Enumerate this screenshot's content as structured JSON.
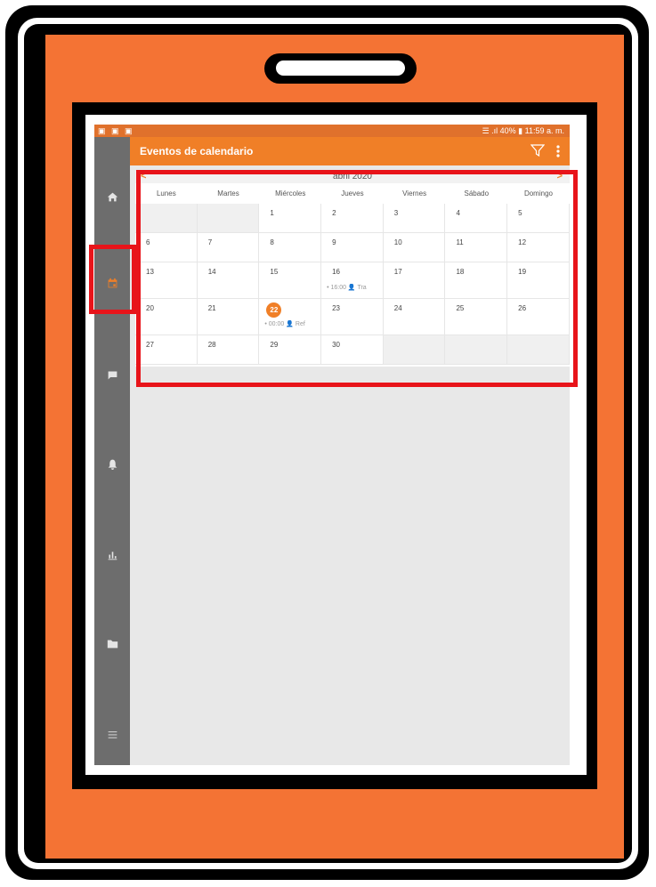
{
  "status_bar": {
    "left_icons": "▣ ▣ ▣",
    "right_text": "☰ .ıl 40% ▮ 11:59 a. m."
  },
  "app_bar": {
    "title": "Eventos de calendario",
    "icons": [
      "filter-icon",
      "more-vert-icon"
    ]
  },
  "nav": [
    {
      "name": "home",
      "icon": "home-icon"
    },
    {
      "name": "calendar",
      "icon": "calendar-icon",
      "active": true
    },
    {
      "name": "messages",
      "icon": "chat-icon"
    },
    {
      "name": "notifications",
      "icon": "bell-icon"
    },
    {
      "name": "reports",
      "icon": "bar-chart-icon"
    },
    {
      "name": "files",
      "icon": "folder-icon"
    },
    {
      "name": "menu",
      "icon": "menu-icon"
    }
  ],
  "calendar": {
    "month": "abril 2020",
    "prev": "<",
    "next": ">",
    "weekdays": [
      "Lunes",
      "Martes",
      "Miércoles",
      "Jueves",
      "Viernes",
      "Sábado",
      "Domingo"
    ],
    "weeks": [
      [
        {
          "d": ""
        },
        {
          "d": ""
        },
        {
          "d": "1"
        },
        {
          "d": "2"
        },
        {
          "d": "3"
        },
        {
          "d": "4"
        },
        {
          "d": "5"
        }
      ],
      [
        {
          "d": "6"
        },
        {
          "d": "7"
        },
        {
          "d": "8"
        },
        {
          "d": "9"
        },
        {
          "d": "10"
        },
        {
          "d": "11"
        },
        {
          "d": "12"
        }
      ],
      [
        {
          "d": "13"
        },
        {
          "d": "14"
        },
        {
          "d": "15"
        },
        {
          "d": "16",
          "event": "• 16:00 👤 Tra"
        },
        {
          "d": "17"
        },
        {
          "d": "18"
        },
        {
          "d": "19"
        }
      ],
      [
        {
          "d": "20"
        },
        {
          "d": "21"
        },
        {
          "d": "22",
          "today": true,
          "event": "• 00:00 👤 Ref"
        },
        {
          "d": "23"
        },
        {
          "d": "24"
        },
        {
          "d": "25"
        },
        {
          "d": "26"
        }
      ],
      [
        {
          "d": "27"
        },
        {
          "d": "28"
        },
        {
          "d": "29"
        },
        {
          "d": "30"
        },
        {
          "d": ""
        },
        {
          "d": ""
        },
        {
          "d": ""
        }
      ]
    ]
  },
  "colors": {
    "accent": "#f07f27",
    "highlight": "#e8141a",
    "frame": "#f47334",
    "sidebar": "#6d6d6d"
  }
}
